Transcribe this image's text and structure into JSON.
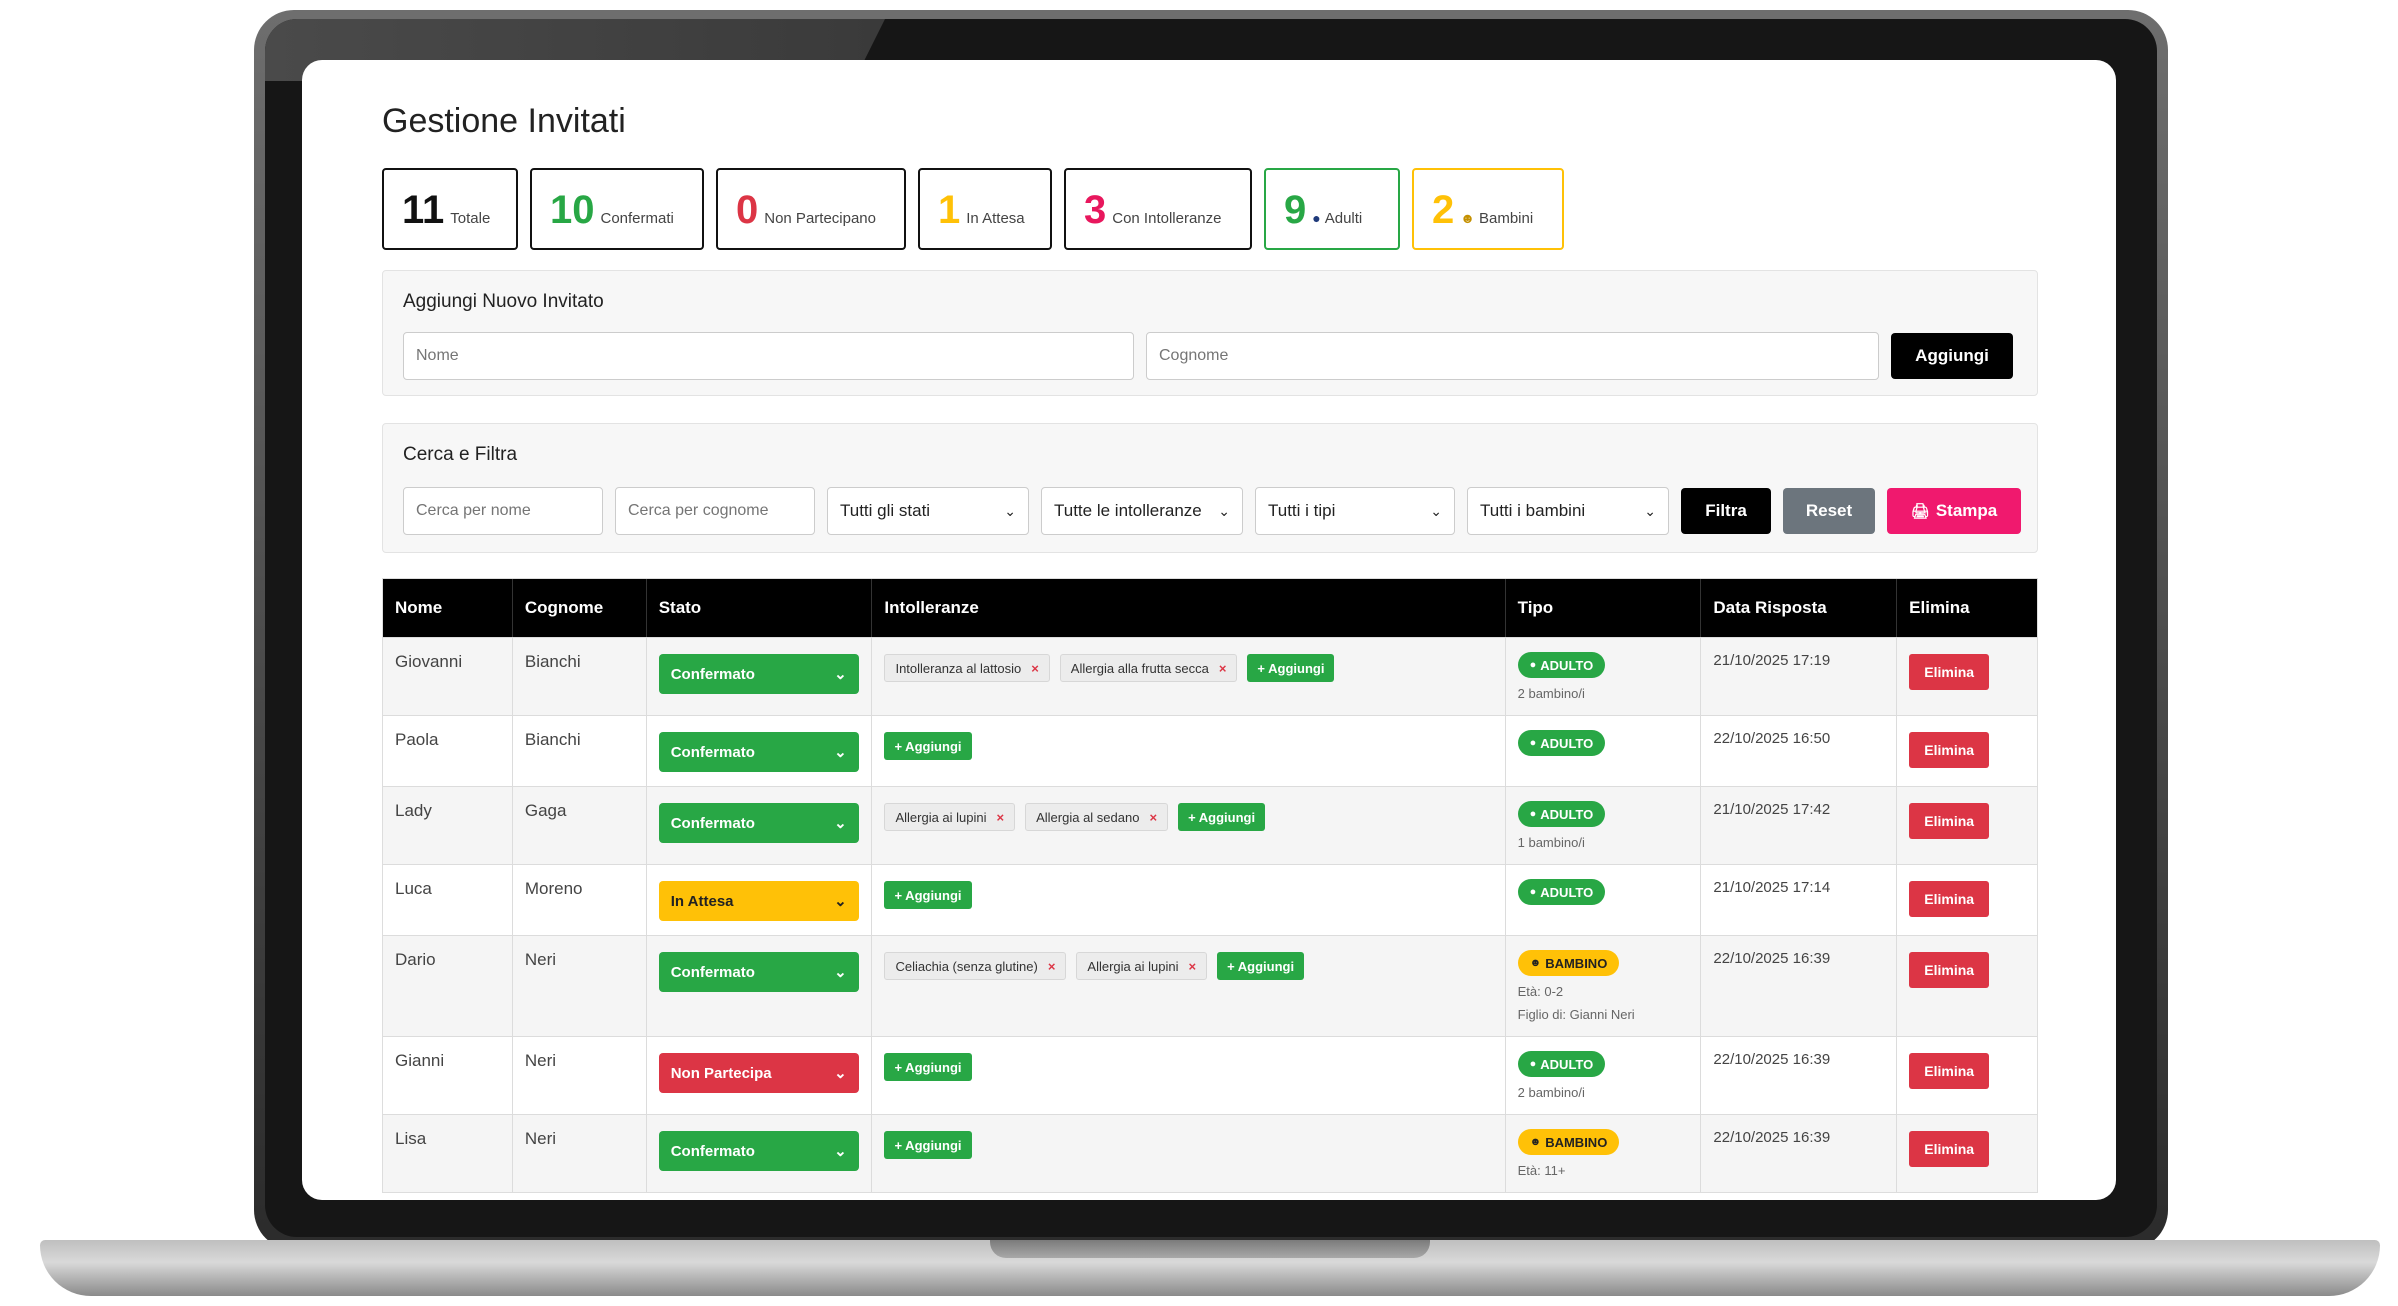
{
  "page_title": "Gestione Invitati",
  "stats": [
    {
      "num": "11",
      "label": "Totale",
      "color": "#111111"
    },
    {
      "num": "10",
      "label": "Confermati",
      "color": "#28a745"
    },
    {
      "num": "0",
      "label": "Non Partecipano",
      "color": "#dc3545"
    },
    {
      "num": "1",
      "label": "In Attesa",
      "color": "#ffc107"
    },
    {
      "num": "3",
      "label": "Con Intolleranze",
      "color": "#e8175d"
    },
    {
      "num": "9",
      "label": "Adulti",
      "color": "#28a745",
      "icon": "person-icon"
    },
    {
      "num": "2",
      "label": "Bambini",
      "color": "#ffc107",
      "icon": "baby-icon"
    }
  ],
  "add_form": {
    "title": "Aggiungi Nuovo Invitato",
    "nome_placeholder": "Nome",
    "cognome_placeholder": "Cognome",
    "add_label": "Aggiungi"
  },
  "filter": {
    "title": "Cerca e Filtra",
    "search_nome_placeholder": "Cerca per nome",
    "search_cognome_placeholder": "Cerca per cognome",
    "stati": "Tutti gli stati",
    "intolleranze": "Tutte le intolleranze",
    "tipi": "Tutti i tipi",
    "bambini": "Tutti i bambini",
    "filtra_label": "Filtra",
    "reset_label": "Reset",
    "stampa_label": "Stampa"
  },
  "table": {
    "headers": [
      "Nome",
      "Cognome",
      "Stato",
      "Intolleranze",
      "Tipo",
      "Data Risposta",
      "Elimina"
    ],
    "add_tag_label": "+ Aggiungi",
    "delete_label": "Elimina",
    "rows": [
      {
        "nome": "Giovanni",
        "cognome": "Bianchi",
        "stato": "Confermato",
        "stato_color": "green",
        "tags": [
          "Intolleranza al lattosio",
          "Allergia alla frutta secca"
        ],
        "tipo": "ADULTO",
        "tipo_color": "green",
        "info": [
          "2 bambino/i"
        ],
        "data": "21/10/2025 17:19"
      },
      {
        "nome": "Paola",
        "cognome": "Bianchi",
        "stato": "Confermato",
        "stato_color": "green",
        "tags": [],
        "tipo": "ADULTO",
        "tipo_color": "green",
        "info": [],
        "data": "22/10/2025 16:50"
      },
      {
        "nome": "Lady",
        "cognome": "Gaga",
        "stato": "Confermato",
        "stato_color": "green",
        "tags": [
          "Allergia ai lupini",
          "Allergia al sedano"
        ],
        "tipo": "ADULTO",
        "tipo_color": "green",
        "info": [
          "1 bambino/i"
        ],
        "data": "21/10/2025 17:42"
      },
      {
        "nome": "Luca",
        "cognome": "Moreno",
        "stato": "In Attesa",
        "stato_color": "yellow",
        "tags": [],
        "tipo": "ADULTO",
        "tipo_color": "green",
        "info": [],
        "data": "21/10/2025 17:14"
      },
      {
        "nome": "Dario",
        "cognome": "Neri",
        "stato": "Confermato",
        "stato_color": "green",
        "tags": [
          "Celiachia (senza glutine)",
          "Allergia ai lupini"
        ],
        "tipo": "BAMBINO",
        "tipo_color": "yellow",
        "info": [
          "Età: 0-2",
          "Figlio di: Gianni Neri"
        ],
        "data": "22/10/2025 16:39"
      },
      {
        "nome": "Gianni",
        "cognome": "Neri",
        "stato": "Non Partecipa",
        "stato_color": "red",
        "tags": [],
        "tipo": "ADULTO",
        "tipo_color": "green",
        "info": [
          "2 bambino/i"
        ],
        "data": "22/10/2025 16:39"
      },
      {
        "nome": "Lisa",
        "cognome": "Neri",
        "stato": "Confermato",
        "stato_color": "green",
        "tags": [],
        "tipo": "BAMBINO",
        "tipo_color": "yellow",
        "info": [
          "Età: 11+"
        ],
        "data": "22/10/2025 16:39"
      }
    ]
  }
}
